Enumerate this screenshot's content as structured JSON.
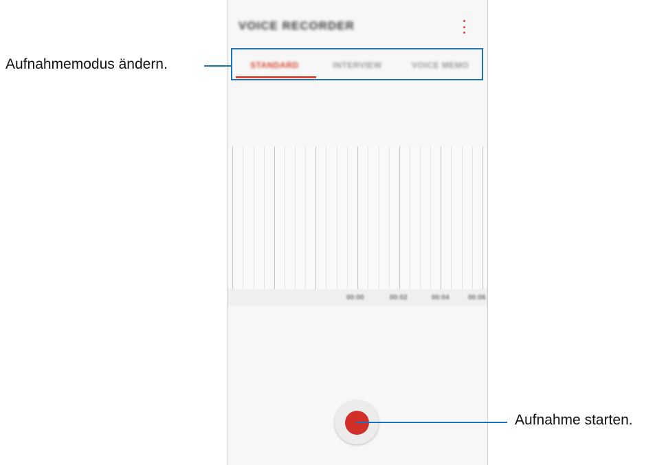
{
  "app": {
    "title": "VOICE RECORDER",
    "more_icon": "more-vertical-icon",
    "accent_color": "#d9472f"
  },
  "tabs": [
    {
      "label": "STANDARD",
      "active": true
    },
    {
      "label": "INTERVIEW",
      "active": false
    },
    {
      "label": "VOICE MEMO",
      "active": false
    }
  ],
  "timeline": {
    "labels": [
      "00:00",
      "00:02",
      "00:04",
      "00:06"
    ]
  },
  "record_button": {
    "icon": "record-icon",
    "color": "#d12f2a"
  },
  "annotations": {
    "mode": "Aufnahmemodus ändern.",
    "record": "Aufnahme starten.",
    "color": "#1a73b8"
  }
}
